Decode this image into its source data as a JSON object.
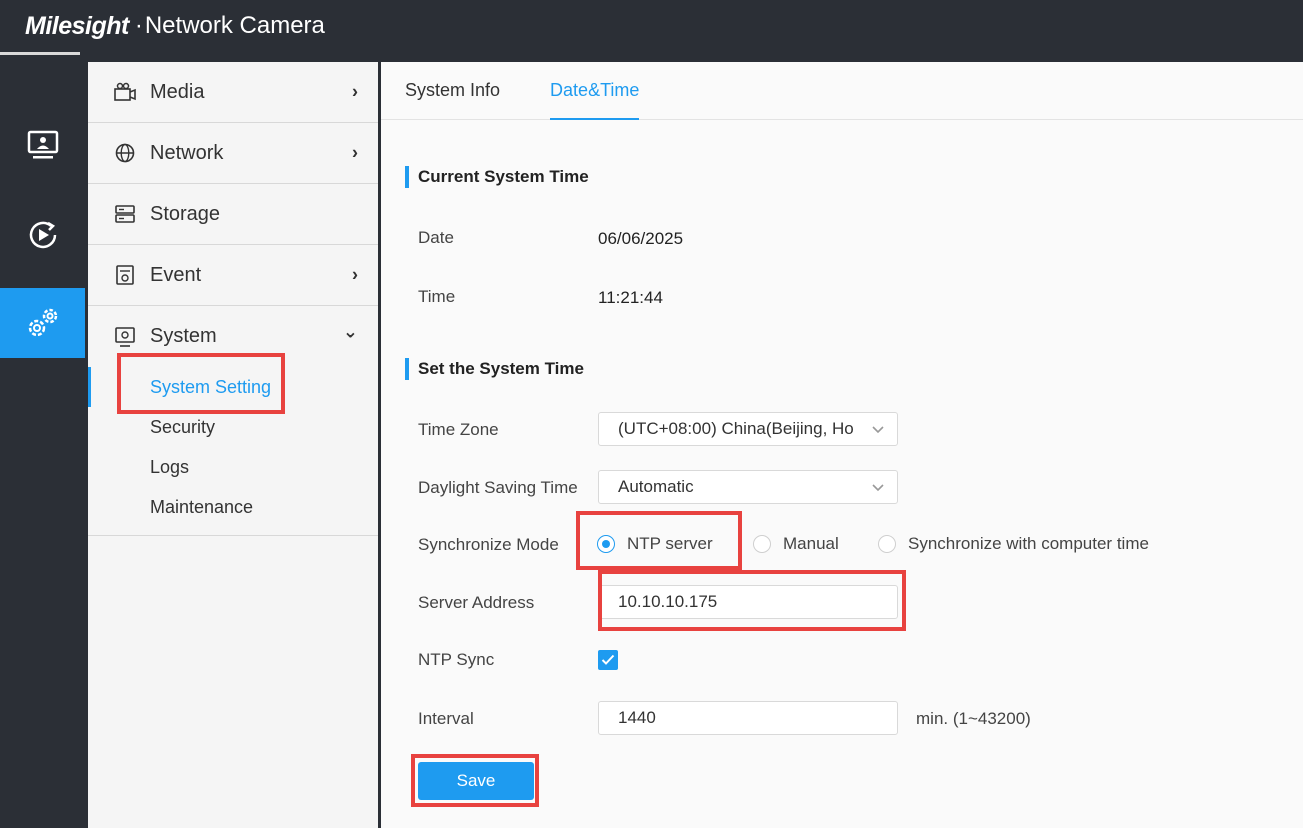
{
  "header": {
    "brand": "Milesight",
    "product": "Network Camera",
    "separator": "·"
  },
  "rail": [
    {
      "name": "live-view",
      "icon": "monitor-icon"
    },
    {
      "name": "playback",
      "icon": "playback-icon"
    },
    {
      "name": "settings",
      "icon": "gear-icon",
      "active": true
    }
  ],
  "sidebar": {
    "media": {
      "label": "Media",
      "arrow": "›"
    },
    "network": {
      "label": "Network",
      "arrow": "›"
    },
    "storage": {
      "label": "Storage"
    },
    "event": {
      "label": "Event",
      "arrow": "›"
    },
    "system": {
      "label": "System",
      "arrow": "⌄",
      "sub": [
        "System Setting",
        "Security",
        "Logs",
        "Maintenance"
      ]
    }
  },
  "tabs": [
    "System Info",
    "Date&Time"
  ],
  "current": {
    "title": "Current System Time",
    "date_label": "Date",
    "date_value": "06/06/2025",
    "time_label": "Time",
    "time_value": "11:21:44"
  },
  "set": {
    "title": "Set the System Time",
    "timezone_label": "Time Zone",
    "timezone_value": "(UTC+08:00) China(Beijing, Ho",
    "dst_label": "Daylight Saving Time",
    "dst_value": "Automatic",
    "sync_label": "Synchronize Mode",
    "sync_options": [
      "NTP server",
      "Manual",
      "Synchronize with computer time"
    ],
    "server_label": "Server Address",
    "server_value": "10.10.10.175",
    "ntp_label": "NTP Sync",
    "interval_label": "Interval",
    "interval_value": "1440",
    "interval_unit": "min. (1~43200)",
    "save_label": "Save"
  },
  "colors": {
    "accent": "#1e9bf0",
    "highlight": "#e8423f",
    "dark": "#2b2f36"
  }
}
